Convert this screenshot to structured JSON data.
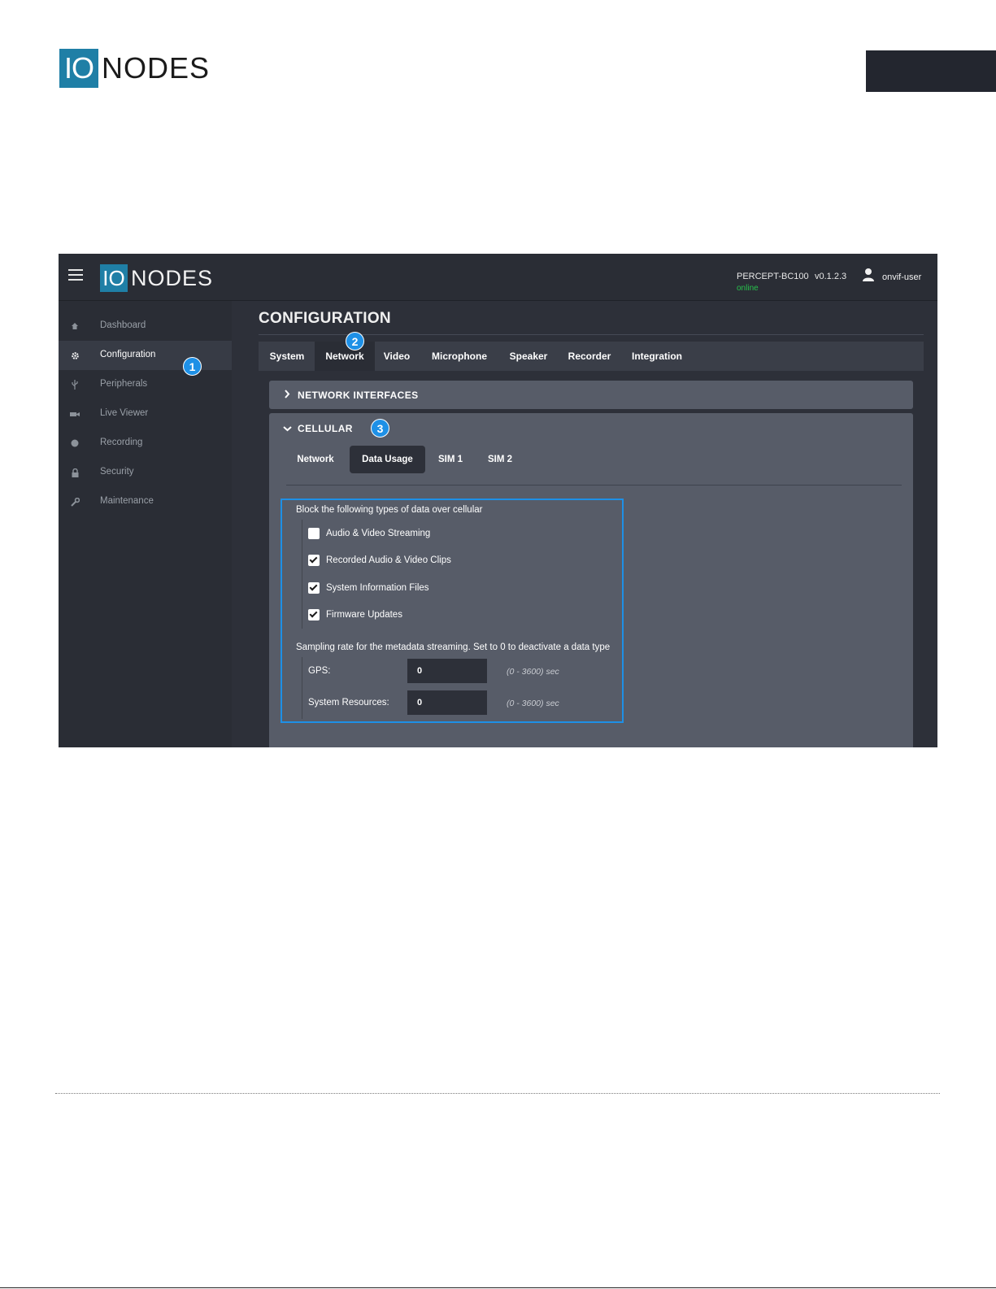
{
  "doc_header": {
    "logo_io": "IO",
    "logo_nodes": "NODES"
  },
  "app": {
    "logo_io": "IO",
    "logo_nodes": "NODES",
    "device_name": "PERCEPT-BC100",
    "device_status": "online",
    "version": "v0.1.2.3",
    "username": "onvif-user",
    "colors": {
      "accent": "#1f7fa6",
      "online": "#27c24c",
      "callout": "#1e90e6"
    }
  },
  "sidebar": {
    "items": [
      {
        "label": "Dashboard",
        "icon": "home-icon",
        "active": false
      },
      {
        "label": "Configuration",
        "icon": "gear-icon",
        "active": true
      },
      {
        "label": "Peripherals",
        "icon": "usb-icon",
        "active": false
      },
      {
        "label": "Live Viewer",
        "icon": "camera-icon",
        "active": false
      },
      {
        "label": "Recording",
        "icon": "record-icon",
        "active": false
      },
      {
        "label": "Security",
        "icon": "lock-icon",
        "active": false
      },
      {
        "label": "Maintenance",
        "icon": "wrench-icon",
        "active": false
      }
    ]
  },
  "callouts": [
    "1",
    "2",
    "3"
  ],
  "main": {
    "title": "CONFIGURATION",
    "tabs": [
      {
        "label": "System",
        "active": false
      },
      {
        "label": "Network",
        "active": true
      },
      {
        "label": "Video",
        "active": false
      },
      {
        "label": "Microphone",
        "active": false
      },
      {
        "label": "Speaker",
        "active": false
      },
      {
        "label": "Recorder",
        "active": false
      },
      {
        "label": "Integration",
        "active": false
      }
    ],
    "network_interfaces": {
      "title": "NETWORK INTERFACES",
      "expanded": false
    },
    "cellular": {
      "title": "CELLULAR",
      "expanded": true,
      "subtabs": [
        {
          "label": "Network",
          "active": false
        },
        {
          "label": "Data Usage",
          "active": true
        },
        {
          "label": "SIM 1",
          "active": false
        },
        {
          "label": "SIM 2",
          "active": false
        }
      ],
      "block_label": "Block the following types of data over cellular",
      "block_options": [
        {
          "label": "Audio & Video Streaming",
          "checked": false
        },
        {
          "label": "Recorded Audio & Video Clips",
          "checked": true
        },
        {
          "label": "System Information Files",
          "checked": true
        },
        {
          "label": "Firmware Updates",
          "checked": true
        }
      ],
      "sampling_label": "Sampling rate for the metadata streaming. Set to 0 to deactivate a data type",
      "fields": [
        {
          "label": "GPS:",
          "value": "0",
          "range": "(0 - 3600) sec"
        },
        {
          "label": "System Resources:",
          "value": "0",
          "range": "(0 - 3600) sec"
        }
      ]
    }
  }
}
